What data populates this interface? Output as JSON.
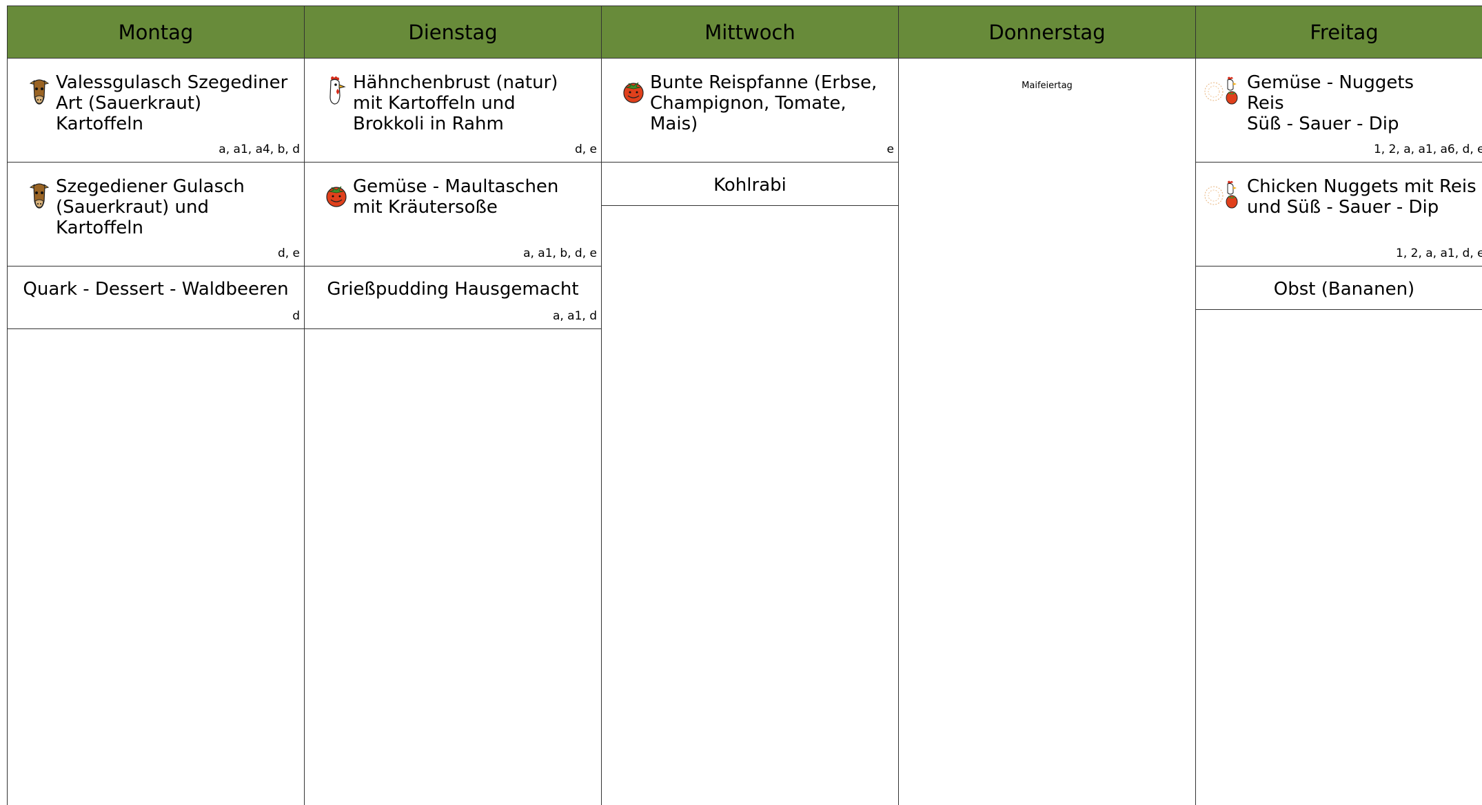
{
  "days": [
    {
      "name": "Montag",
      "items": [
        {
          "kind": "meal",
          "icon": "cow-icon",
          "name": "Valessgulasch Szegediner\nArt (Sauerkraut)\nKartoffeln",
          "allergens": "a, a1, a4, b, d"
        },
        {
          "kind": "meal",
          "icon": "cow-icon",
          "name": "Szegediener Gulasch\n(Sauerkraut) und\nKartoffeln",
          "allergens": "d, e"
        },
        {
          "kind": "dessert",
          "name": "Quark - Dessert - Waldbeeren",
          "allergens": "d"
        }
      ]
    },
    {
      "name": "Dienstag",
      "items": [
        {
          "kind": "meal",
          "icon": "chicken-icon",
          "name": "Hähnchenbrust (natur)\nmit Kartoffeln und\nBrokkoli in Rahm",
          "allergens": "d, e"
        },
        {
          "kind": "meal",
          "icon": "tomato-icon",
          "name": "Gemüse - Maultaschen\nmit Kräutersoße",
          "allergens": "a, a1, b, d, e"
        },
        {
          "kind": "dessert",
          "name": "Grießpudding Hausgemacht",
          "allergens": "a, a1, d"
        }
      ]
    },
    {
      "name": "Mittwoch",
      "items": [
        {
          "kind": "meal",
          "icon": "tomato-icon",
          "name": "Bunte Reispfanne (Erbse,\nChampignon, Tomate,\nMais)",
          "allergens": "e"
        },
        {
          "kind": "dessert",
          "name": "Kohlrabi",
          "allergens": ""
        }
      ]
    },
    {
      "name": "Donnerstag",
      "holiday": "Maifeiertag",
      "items": []
    },
    {
      "name": "Freitag",
      "items": [
        {
          "kind": "meal",
          "icon": "chicken-tomato-icon",
          "name": "Gemüse - Nuggets\nReis\nSüß - Sauer - Dip",
          "allergens": "1, 2, a, a1, a6, d, e,"
        },
        {
          "kind": "meal",
          "icon": "chicken-tomato-icon",
          "name": "Chicken Nuggets mit Reis\nund Süß - Sauer - Dip",
          "allergens": "1, 2, a, a1, d, e,"
        },
        {
          "kind": "dessert",
          "name": "Obst (Bananen)",
          "allergens": ""
        }
      ]
    }
  ],
  "colors": {
    "header": "#688b3a",
    "grid": "#333333"
  }
}
